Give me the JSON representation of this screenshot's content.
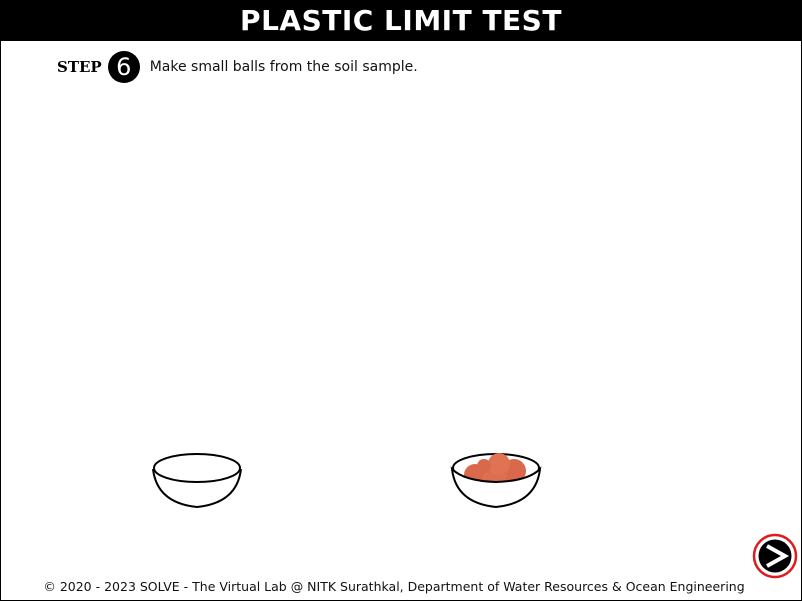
{
  "header": {
    "title": "PLASTIC LIMIT TEST"
  },
  "step": {
    "label": "STEP",
    "number": "6",
    "instruction": "Make small balls from the soil sample."
  },
  "scene": {
    "ball_color": "#d9694a",
    "ball_count": 5
  },
  "navigation": {
    "next_icon": "next-arrow-icon"
  },
  "footer": {
    "copyright": "© 2020 - 2023 SOLVE - The Virtual Lab @ NITK Surathkal, Department of Water Resources & Ocean Engineering"
  }
}
